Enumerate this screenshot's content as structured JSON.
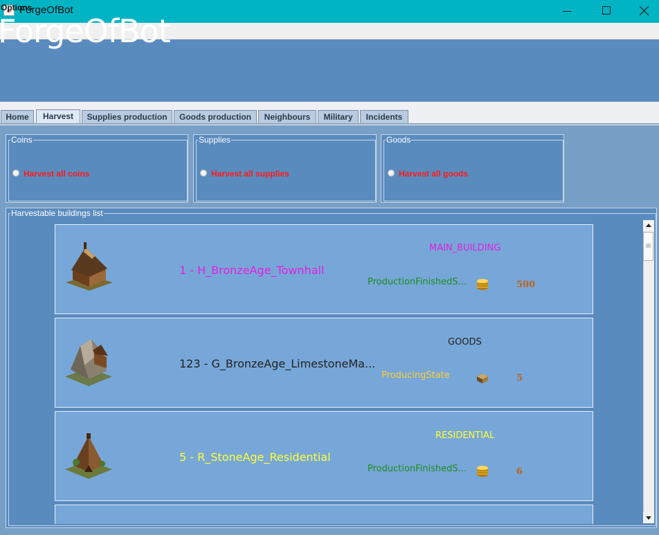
{
  "window": {
    "title": "ForgeOfBot"
  },
  "menu": {
    "options": "Options"
  },
  "header": {
    "title": "ForgeOfBot"
  },
  "tabs": [
    {
      "label": "Home"
    },
    {
      "label": "Harvest",
      "active": true
    },
    {
      "label": "Supplies production"
    },
    {
      "label": "Goods production"
    },
    {
      "label": "Neighbours"
    },
    {
      "label": "Military"
    },
    {
      "label": "Incidents"
    }
  ],
  "groups": {
    "coins": {
      "title": "Coins",
      "option": "Harvest all coins"
    },
    "supplies": {
      "title": "Supplies",
      "option": "Harvest all supplies"
    },
    "goods": {
      "title": "Goods",
      "option": "Harvest all goods"
    }
  },
  "list": {
    "title": "Harvestable buildings list",
    "buildings": [
      {
        "name": "1 - H_BronzeAge_Townhall",
        "name_color": "#e020e0",
        "type": "MAIN_BUILDING",
        "type_color": "#e020e0",
        "state": "ProductionFinishedS...",
        "state_color": "#1f8a1f",
        "resource_icon": "coins-icon",
        "amount": "500"
      },
      {
        "name": "123 - G_BronzeAge_LimestoneMa...",
        "name_color": "#222222",
        "type": "GOODS",
        "type_color": "#222222",
        "state": "ProducingState",
        "state_color": "#ffcc33",
        "resource_icon": "goods-crate-icon",
        "amount": "5"
      },
      {
        "name": "5 - R_StoneAge_Residential",
        "name_color": "#ffff33",
        "type": "RESIDENTIAL",
        "type_color": "#ffff33",
        "state": "ProductionFinishedS...",
        "state_color": "#1f8a1f",
        "resource_icon": "coins-icon",
        "amount": "6"
      }
    ]
  }
}
